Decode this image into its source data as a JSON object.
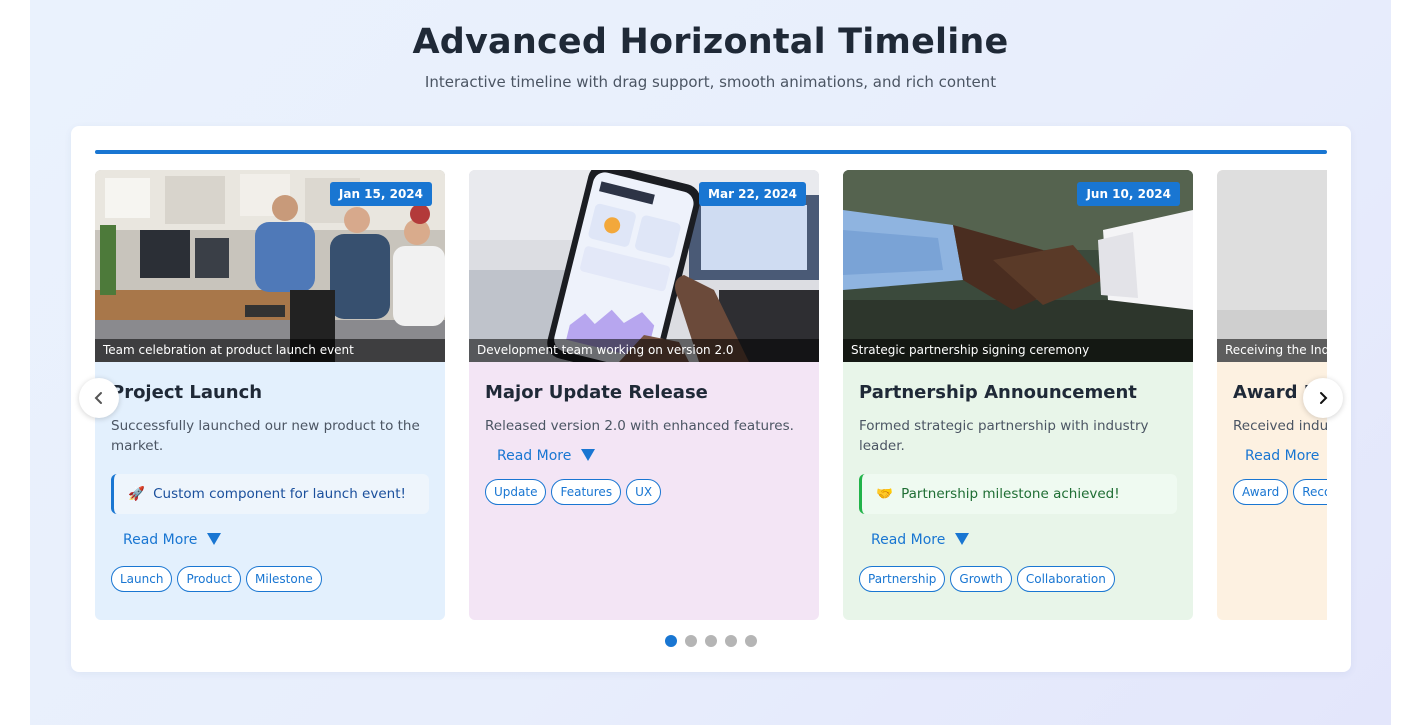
{
  "header": {
    "title": "Advanced Horizontal Timeline",
    "subtitle": "Interactive timeline with drag support, smooth animations, and rich content"
  },
  "colors": {
    "accent": "#1976d2",
    "dot_inactive": "#b5b5b5"
  },
  "timeline": {
    "cards": [
      {
        "date": "Jan 15, 2024",
        "caption": "Team celebration at product launch event",
        "title": "Project Launch",
        "description": "Successfully launched our new product to the market.",
        "callout": {
          "icon": "rocket-icon",
          "glyph": "🚀",
          "text": "Custom component for launch event!"
        },
        "read_more": "Read More",
        "tags": [
          "Launch",
          "Product",
          "Milestone"
        ],
        "background": "#e3f0fd"
      },
      {
        "date": "Mar 22, 2024",
        "caption": "Development team working on version 2.0",
        "title": "Major Update Release",
        "description": "Released version 2.0 with enhanced features.",
        "read_more": "Read More",
        "tags": [
          "Update",
          "Features",
          "UX"
        ],
        "background": "#f3e5f5"
      },
      {
        "date": "Jun 10, 2024",
        "caption": "Strategic partnership signing ceremony",
        "title": "Partnership Announcement",
        "description": "Formed strategic partnership with industry leader.",
        "callout": {
          "icon": "handshake-icon",
          "glyph": "🤝",
          "text": "Partnership milestone achieved!"
        },
        "read_more": "Read More",
        "tags": [
          "Partnership",
          "Growth",
          "Collaboration"
        ],
        "background": "#e8f5e9"
      },
      {
        "caption": "Receiving the Indus",
        "title": "Award Re",
        "description": "Received indust",
        "read_more": "Read More",
        "tags": [
          "Award",
          "Reco"
        ],
        "background": "#fdf1e1"
      }
    ],
    "pagination": {
      "count": 5,
      "active": 1
    }
  }
}
